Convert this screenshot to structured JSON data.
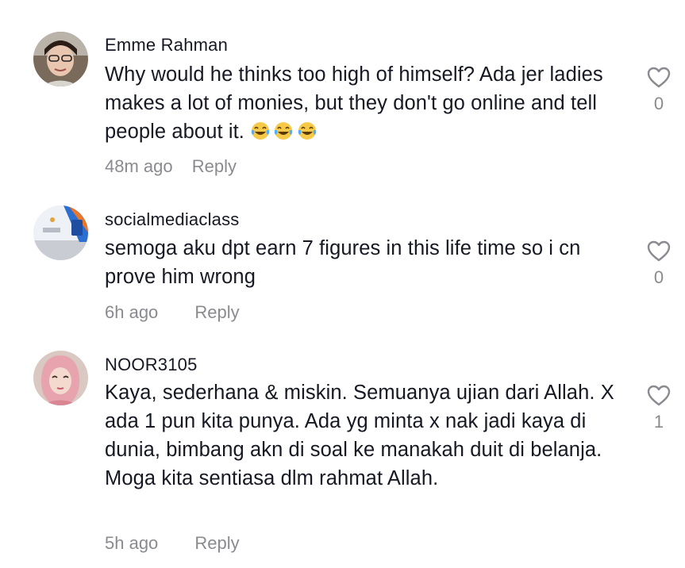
{
  "comments": [
    {
      "username": "Emme Rahman",
      "text": "Why would he thinks too high of himself? Ada jer ladies makes a lot of monies, but they don't go online and tell people about it.",
      "emojis": [
        "face-with-tears-of-joy",
        "face-with-tears-of-joy",
        "face-with-tears-of-joy"
      ],
      "time": "48m ago",
      "reply_label": "Reply",
      "likes": "0",
      "like_icon": "heart-outline-icon"
    },
    {
      "username": "socialmediaclass",
      "text": "semoga aku dpt earn 7 figures in this life time so i cn prove him wrong",
      "time": "6h ago",
      "reply_label": "Reply",
      "likes": "0",
      "like_icon": "heart-outline-icon"
    },
    {
      "username": "NOOR3105",
      "text": "Kaya, sederhana & miskin. Semuanya ujian dari Allah. X ada 1 pun kita punya. Ada yg minta x nak jadi kaya di dunia, bimbang akn di soal ke manakah duit di belanja. Moga kita sentiasa dlm rahmat Allah.",
      "time": "5h ago",
      "reply_label": "Reply",
      "likes": "1",
      "like_icon": "heart-outline-icon"
    }
  ],
  "colors": {
    "text": "#161823",
    "secondary": "#8a8b91",
    "background": "#ffffff"
  }
}
